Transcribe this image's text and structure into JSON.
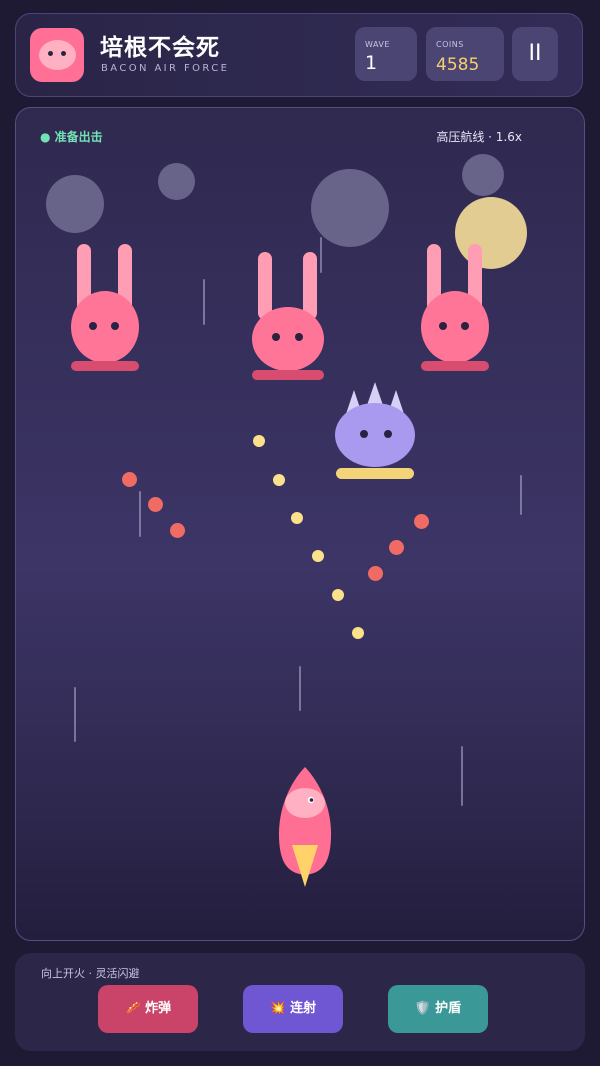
{
  "header": {
    "title": "培根不会死",
    "subtitle": "BACON AIR FORCE",
    "wave": {
      "label": "WAVE",
      "value": "1"
    },
    "coins": {
      "label": "COINS",
      "value": "4585"
    },
    "pause_label": "II"
  },
  "arena": {
    "status_left": "● 准备出击",
    "status_right": "高压航线 · 1.6x",
    "enemies": [
      {
        "type": "bunny"
      },
      {
        "type": "bunny"
      },
      {
        "type": "bunny"
      },
      {
        "type": "spiky-boss"
      }
    ]
  },
  "footer": {
    "hint": "向上开火 · 灵活闪避",
    "buttons": [
      {
        "label": "炸弹",
        "icon": "bacon-icon",
        "glyph": "🥓",
        "color": "#c94468"
      },
      {
        "label": "连射",
        "icon": "burst-icon",
        "glyph": "💥",
        "color": "#6f56d3"
      },
      {
        "label": "护盾",
        "icon": "shield-icon",
        "glyph": "🛡️",
        "color": "#3a9997"
      }
    ]
  },
  "colors": {
    "accent_pink": "#ff7597",
    "coin_yellow": "#f7cf6f",
    "status_green": "#72e2b5",
    "player_bullet": "#fbe28a",
    "enemy_bullet": "#f06b63"
  }
}
